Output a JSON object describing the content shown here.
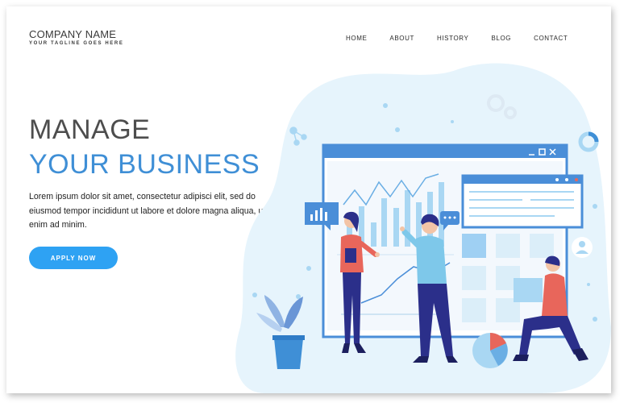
{
  "brand": {
    "name": "COMPANY NAME",
    "tagline": "YOUR TAGLINE GOES HERE"
  },
  "nav": {
    "items": [
      "HOME",
      "ABOUT",
      "HISTORY",
      "BLOG",
      "CONTACT"
    ]
  },
  "hero": {
    "title_line1": "MANAGE",
    "title_line2": "YOUR BUSINESS",
    "body": "Lorem ipsum dolor sit amet, consectetur adipisci elit, sed do eiusmod tempor incididunt ut labore et dolore magna aliqua, ut enim ad minim.",
    "cta": "APPLY NOW"
  },
  "colors": {
    "accent": "#3f8fd6",
    "button": "#2ea2f3",
    "blob": "#e6f4fc",
    "window": "#4a8ed8",
    "shirt_red": "#e8665b",
    "pants_navy": "#2b2f8a"
  },
  "icons": [
    "bar-chart-icon",
    "chat-bubble-icon",
    "gear-icon",
    "user-icon",
    "pie-chart-icon",
    "ring-icon"
  ]
}
